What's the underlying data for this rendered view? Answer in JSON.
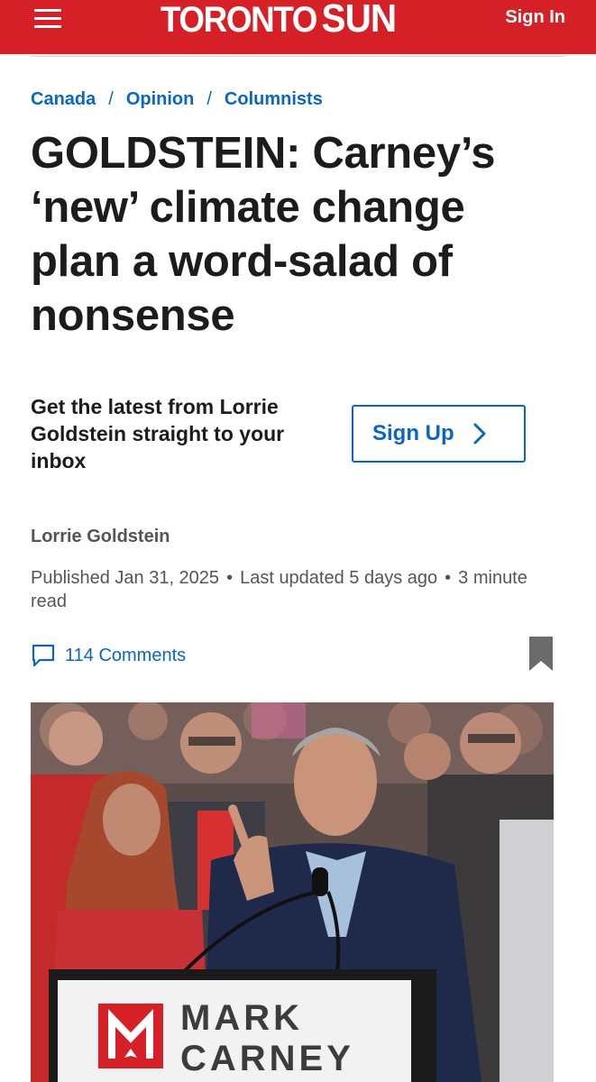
{
  "header": {
    "logo_part1": "TORONTO",
    "logo_part2": "SUN",
    "signin_label": "Sign In"
  },
  "breadcrumb": [
    "Canada",
    "Opinion",
    "Columnists"
  ],
  "article": {
    "title": "GOLDSTEIN: Carney’s ‘new’ climate change plan a word-salad of nonsense",
    "newsletter_text": "Get the latest from Lorrie Goldstein straight to your inbox",
    "signup_label": "Sign Up",
    "author": "Lorrie Goldstein",
    "published": "Published Jan 31, 2025",
    "updated": "Last updated 5 days ago",
    "read_time": "3 minute read",
    "comments_label": "114 Comments",
    "photo": {
      "podium_line1": "MARK",
      "podium_line2": "CARNEY"
    }
  },
  "colors": {
    "brand_red": "#d52027",
    "link_blue": "#0b66c3",
    "text_dark": "#1c1c1c",
    "meta_gray": "#555555"
  }
}
